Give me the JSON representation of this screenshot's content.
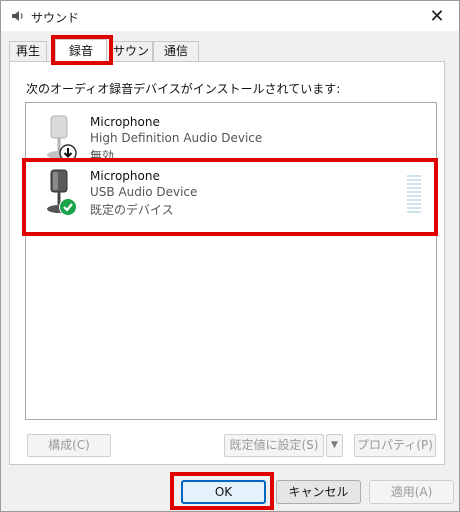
{
  "window": {
    "title": "サウンド",
    "close_glyph": "✕"
  },
  "tabs": [
    {
      "label": "再生",
      "active": false
    },
    {
      "label": "録音",
      "active": true
    },
    {
      "label": "サウンド",
      "active": false
    },
    {
      "label": "通信",
      "active": false
    }
  ],
  "panel": {
    "instruction": "次のオーディオ録音デバイスがインストールされています:",
    "devices": [
      {
        "name": "Microphone",
        "description": "High Definition Audio Device",
        "status": "無効",
        "status_icon": "down-arrow-icon"
      },
      {
        "name": "Microphone",
        "description": "USB Audio Device",
        "status": "既定のデバイス",
        "status_icon": "check-icon"
      }
    ],
    "buttons": {
      "configure": "構成(C)",
      "set_default": "既定値に設定(S)",
      "dropdown_glyph": "▼",
      "properties": "プロパティ(P)"
    }
  },
  "dialog_buttons": {
    "ok": "OK",
    "cancel": "キャンセル",
    "apply": "適用(A)"
  },
  "colors": {
    "highlight": "#e00000",
    "default_check": "#1aa34a",
    "focus_border": "#0067c0"
  }
}
